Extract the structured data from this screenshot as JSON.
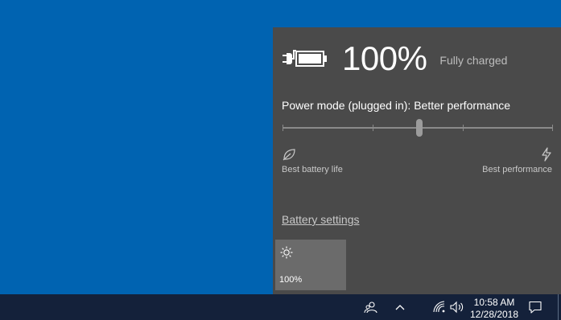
{
  "battery": {
    "percent_label": "100%",
    "status": "Fully charged",
    "icon": "battery-plugged-in-icon"
  },
  "power_mode": {
    "label": "Power mode (plugged in): Better performance",
    "level": 0.5,
    "left_label": "Best battery life",
    "left_icon": "leaf-icon",
    "right_label": "Best performance",
    "right_icon": "lightning-icon"
  },
  "battery_settings_link": "Battery settings",
  "brightness_tile": {
    "label": "100%",
    "icon": "brightness-icon"
  },
  "taskbar": {
    "icons": [
      "people-icon",
      "chevron-up-icon",
      "network-wifi-icon",
      "volume-icon",
      "action-center-icon"
    ],
    "time": "10:58 AM",
    "date": "12/28/2018"
  },
  "colors": {
    "desktop": "#0063b1",
    "flyout": "#4a4a4a",
    "tile": "#6b6b6b",
    "taskbar": "#14213a"
  }
}
